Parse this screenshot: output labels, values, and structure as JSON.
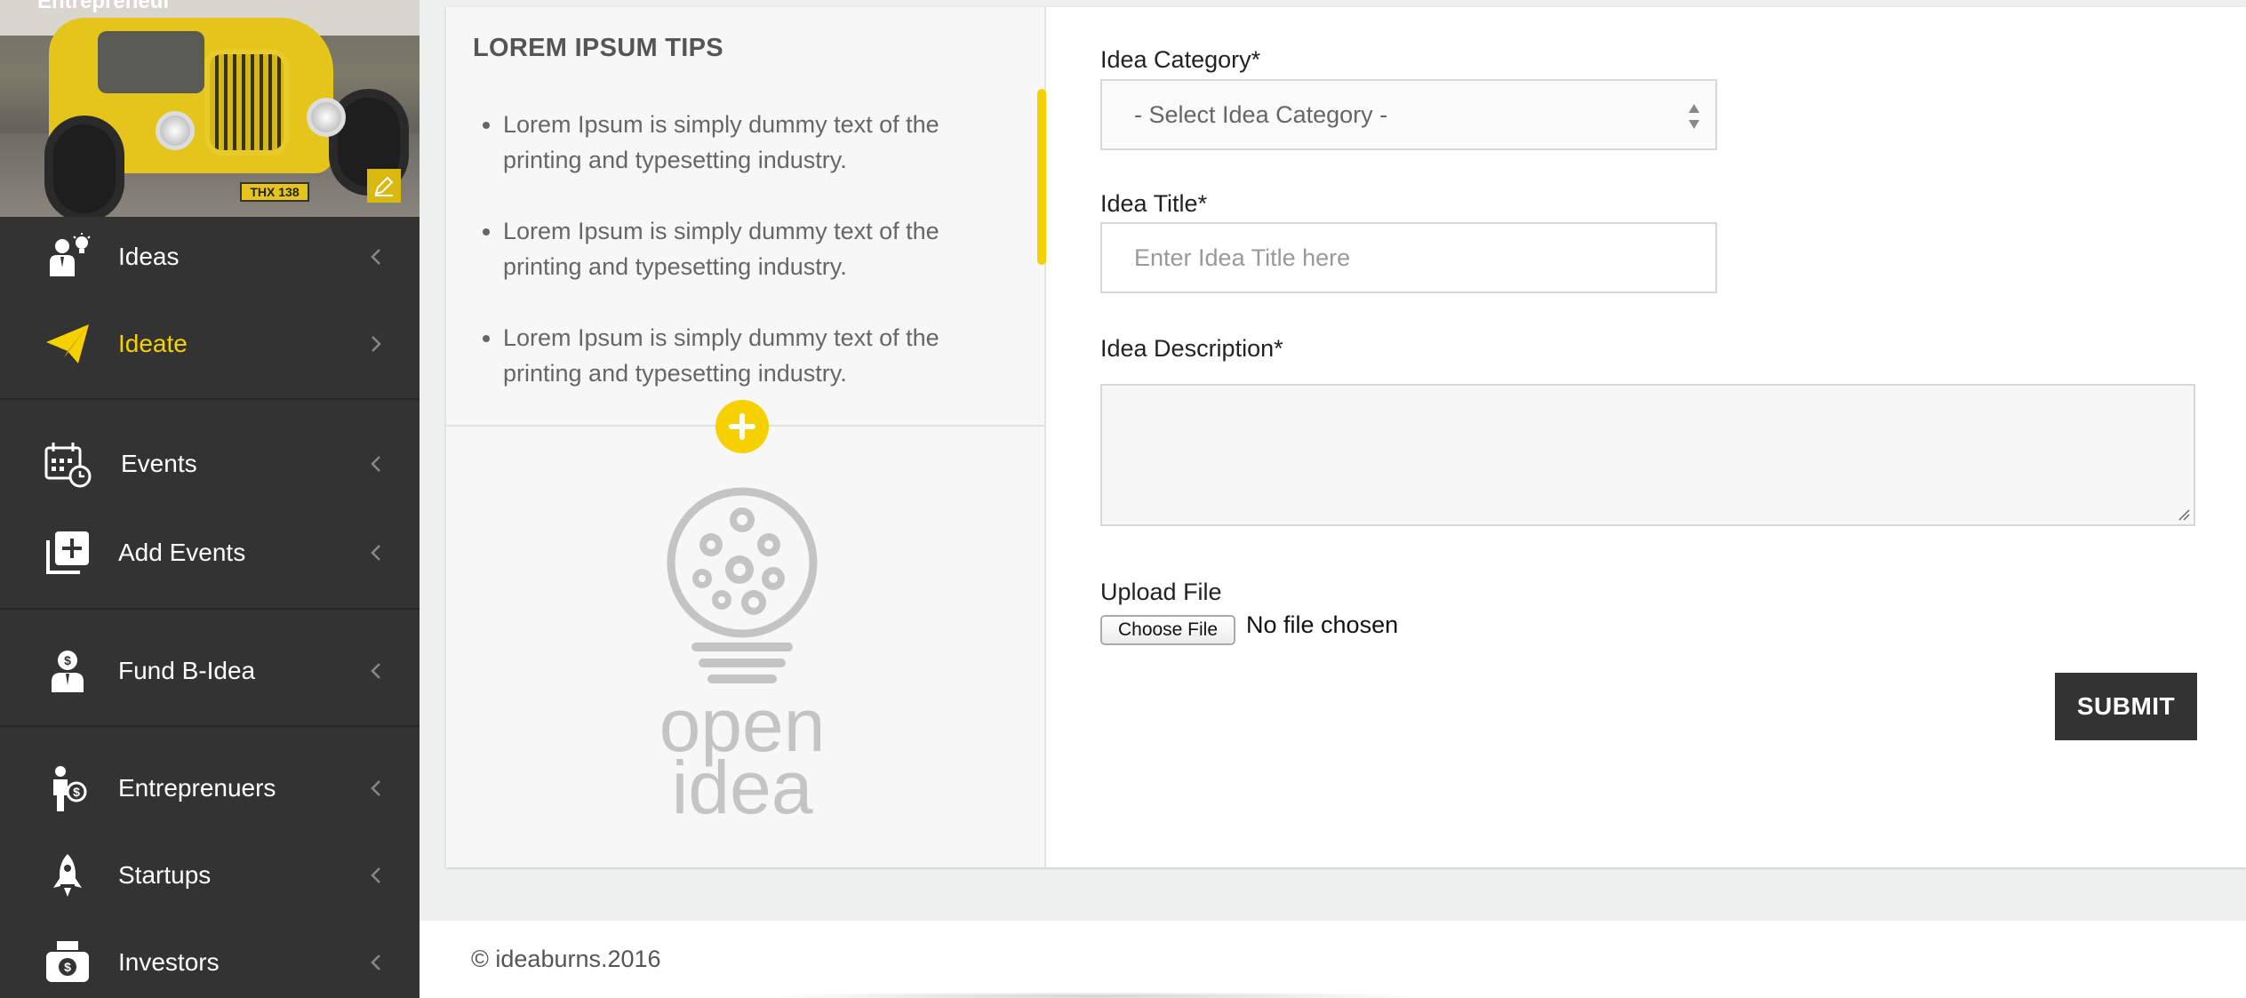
{
  "sidebar": {
    "profile": {
      "caption": "Entrepreneur",
      "plate": "THX 138",
      "edit_icon": "edit-pencil-icon"
    },
    "items": [
      {
        "label": "Ideas",
        "icon": "ideas-person-bulb-icon",
        "active": false
      },
      {
        "label": "Ideate",
        "icon": "paper-plane-icon",
        "active": true
      },
      {
        "label": "Events",
        "icon": "calendar-clock-icon",
        "active": false
      },
      {
        "label": "Add Events",
        "icon": "add-square-icon",
        "active": false
      },
      {
        "label": "Fund B-Idea",
        "icon": "fund-person-dollar-icon",
        "active": false
      },
      {
        "label": "Entreprenuers",
        "icon": "person-dollar-icon",
        "active": false
      },
      {
        "label": "Startups",
        "icon": "rocket-icon",
        "active": false
      },
      {
        "label": "Investors",
        "icon": "cash-register-icon",
        "active": false
      }
    ],
    "accent_color": "#f7d000"
  },
  "tips": {
    "title": "LOREM IPSUM TIPS",
    "items": [
      "Lorem Ipsum is simply dummy text of the printing and typesetting industry.",
      "Lorem Ipsum is simply dummy text of the printing and typesetting industry.",
      "Lorem Ipsum is simply dummy text of the printing and typesetting industry."
    ],
    "logo_line1": "open",
    "logo_line2": "idea"
  },
  "form": {
    "category_label": "Idea Category*",
    "category_selected": "- Select Idea Category -",
    "title_label": "Idea Title*",
    "title_placeholder": "Enter Idea Title here",
    "title_value": "",
    "description_label": "Idea Description*",
    "description_value": "",
    "upload_label": "Upload File",
    "choose_file_label": "Choose File",
    "file_status": "No file chosen",
    "submit_label": "SUBMIT"
  },
  "footer": {
    "copyright": "© ideaburns.2016"
  }
}
